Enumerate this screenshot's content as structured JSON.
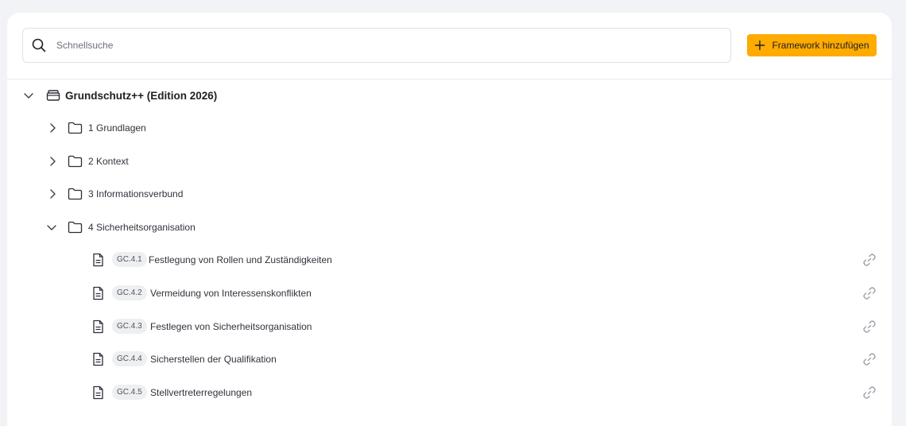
{
  "search": {
    "placeholder": "Schnellsuche",
    "value": ""
  },
  "toolbar": {
    "add_framework_label": "Framework hinzufügen",
    "accent": "#ffab00"
  },
  "tree": {
    "root": {
      "label": "Grundschutz++ (Edition 2026)",
      "expanded": true
    },
    "folders": [
      {
        "label": "1 Grundlagen",
        "expanded": false
      },
      {
        "label": "2 Kontext",
        "expanded": false
      },
      {
        "label": "3 Informationsverbund",
        "expanded": false
      },
      {
        "label": "4 Sicherheitsorganisation",
        "expanded": true
      }
    ],
    "documents": [
      {
        "code": "GC.4.1",
        "title": "Festlegung von Rollen und Zuständigkeiten"
      },
      {
        "code": "GC.4.2",
        "title": "Vermeidung von Interessenskonflikten"
      },
      {
        "code": "GC.4.3",
        "title": "Festlegen von Sicherheitsorganisation"
      },
      {
        "code": "GC.4.4",
        "title": "Sicherstellen der Qualifikation"
      },
      {
        "code": "GC.4.5",
        "title": "Stellvertreterregelungen"
      }
    ]
  }
}
